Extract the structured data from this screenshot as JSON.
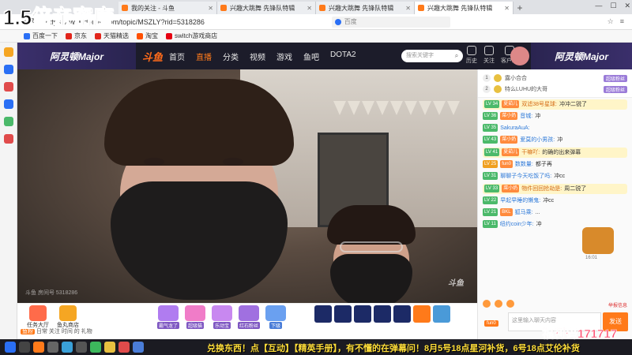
{
  "overlay": {
    "title": "1.5倍亲密度",
    "ticker": "兑换东西！点【互动】【精英手册】，有不懂的在弹幕问！8月5号18点星河补货，6号18点艾伦补货",
    "code": "福利码171717"
  },
  "browser": {
    "tabs": [
      {
        "label": "我的关注 - 斗鱼"
      },
      {
        "label": "兴趣大跳舞 先锋队特辑"
      },
      {
        "label": "兴趣大跳舞 先锋队特辑"
      },
      {
        "label": "兴趣大跳舞 先锋队特辑"
      },
      {
        "label": "兴趣大跳舞 先锋队特辑"
      }
    ],
    "url": "https://www.douyu.com/topic/MSZLY?rid=5318286",
    "search_engine": "百度",
    "bookmarks": [
      "百度一下",
      "京东",
      "天猫精选",
      "淘宝",
      "switch游戏商店"
    ]
  },
  "douyu": {
    "brand_left": "阿灵顿Major",
    "logo": "斗鱼",
    "nav": [
      "首页",
      "直播",
      "分类",
      "视频",
      "游戏",
      "鱼吧",
      "DOTA2"
    ],
    "search_placeholder": "搜索关键字",
    "icons": [
      "历史",
      "关注",
      "客户端"
    ],
    "brand_right": "阿灵顿Major"
  },
  "video": {
    "watermark": "斗鱼 房间号 5318286",
    "corner_logo": "斗鱼"
  },
  "giftbar": {
    "left_items": [
      {
        "label": "任务大厅",
        "color": "#ff6b4a"
      },
      {
        "label": "鱼丸商店",
        "color": "#f5a623"
      }
    ],
    "gifts": [
      {
        "label": "霸气龙了",
        "color": "#7e57c2"
      },
      {
        "label": "超级猫",
        "color": "#7e57c2"
      },
      {
        "label": "乐动宝",
        "color": "#7e57c2"
      },
      {
        "label": "红石粉丝",
        "color": "#7e57c2"
      },
      {
        "label": "下级",
        "color": "#4a7dd8"
      }
    ],
    "chat_hint": "日常 关注 时间 的 礼物"
  },
  "chat": {
    "rank": [
      {
        "num": "1",
        "name": "露小合合",
        "badge": "超级粉丝"
      },
      {
        "num": "2",
        "name": "特么LUHU的大哥",
        "badge": "超级粉丝"
      }
    ],
    "messages": [
      {
        "lv": "LV 34",
        "lvColor": "#4bb96a",
        "fan": "夏茹儿",
        "user": "双滤38号星球:",
        "text": "冲冲二锐了",
        "hl": true
      },
      {
        "lv": "LV 36",
        "lvColor": "#4bb96a",
        "fan": "菜小奶",
        "user": "音城:",
        "text": "冲"
      },
      {
        "lv": "LV 35",
        "lvColor": "#4bb96a",
        "fan": "",
        "user": "SakuraAuA:",
        "text": ""
      },
      {
        "lv": "LV 43",
        "lvColor": "#4bb96a",
        "fan": "菜小奶",
        "user": "爱莫的小男孩:",
        "text": "冲"
      },
      {
        "lv": "LV 41",
        "lvColor": "#4bb96a",
        "fan": "夏茹儿",
        "user": "干嘛吖:",
        "text": "的确的出来弹幕",
        "hl": true
      },
      {
        "lv": "LV 25",
        "lvColor": "#f0a020",
        "fan": "fun0",
        "user": "数数量:",
        "text": "都子再"
      },
      {
        "lv": "LV 31",
        "lvColor": "#4bb96a",
        "fan": "",
        "user": "聊聊子今天吃饭了吗:",
        "text": "冲cc"
      },
      {
        "lv": "LV 33",
        "lvColor": "#4bb96a",
        "fan": "菜小奶",
        "user": "物件回回抢劫是:",
        "text": "周二锐了",
        "hl": true
      },
      {
        "lv": "LV 22",
        "lvColor": "#4bb96a",
        "fan": "",
        "user": "早起早睡的懒鬼:",
        "text": "冲cc"
      },
      {
        "lv": "LV 21",
        "lvColor": "#4bb96a",
        "fan": "BKL",
        "user": "狐马乘:",
        "text": "..."
      },
      {
        "lv": "LV 11",
        "lvColor": "#4bb96a",
        "fan": "",
        "user": "纽约coin少年:",
        "text": "冲"
      }
    ],
    "chest_time": "16:01",
    "report": "举报信息",
    "input_placeholder": "这里输入聊天内容",
    "send": "发送",
    "fans_tag": "fun0"
  },
  "colors": {
    "accent": "#ff7a1a",
    "header_bg": "#1c1c2a"
  }
}
